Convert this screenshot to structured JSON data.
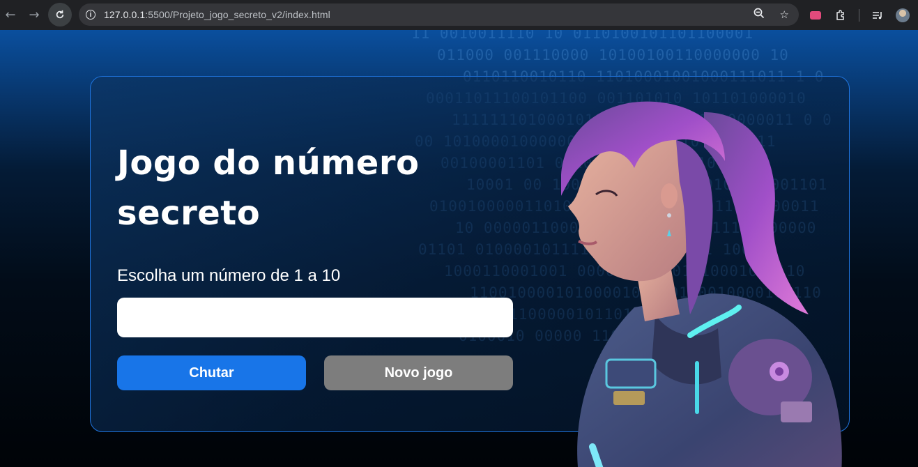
{
  "browser": {
    "url_host": "127.0.0.1",
    "url_rest": ":5500/Projeto_jogo_secreto_v2/index.html"
  },
  "page": {
    "title": "Jogo do número secreto",
    "prompt": "Escolha um número de 1 a 10",
    "input_value": "",
    "guess_button": "Chutar",
    "new_game_button": "Novo jogo"
  },
  "background_binary": [
    "11 0010011110 10 0110100101101100001",
    "011000 001110000 10100100110000000 10",
    "0110110010110 11010001001000111011 1 0",
    "00011011100101100 001101010 101101000010",
    "1111111010001010100000 0101010000011 0 0",
    "00 101000010000001100000010110 0001011",
    "00100001101 01100011110000010 0",
    "10001 00 10011100100111010101000001101",
    "01001000001101000000101011100011000100011",
    "10 00000110001100010001011011110000000",
    "01101 01000010111100010011100 1 1000",
    "1000110001001 000011000001010001000110",
    "1100100001010000101 00110010000100110",
    "11010000110000010110100000 1 1 0 0",
    "0100010 00000 1100 110110 1 0"
  ],
  "colors": {
    "guess_button": "#1875e8",
    "new_game_button": "#7d7d7d",
    "card_border": "#1f75e0"
  }
}
